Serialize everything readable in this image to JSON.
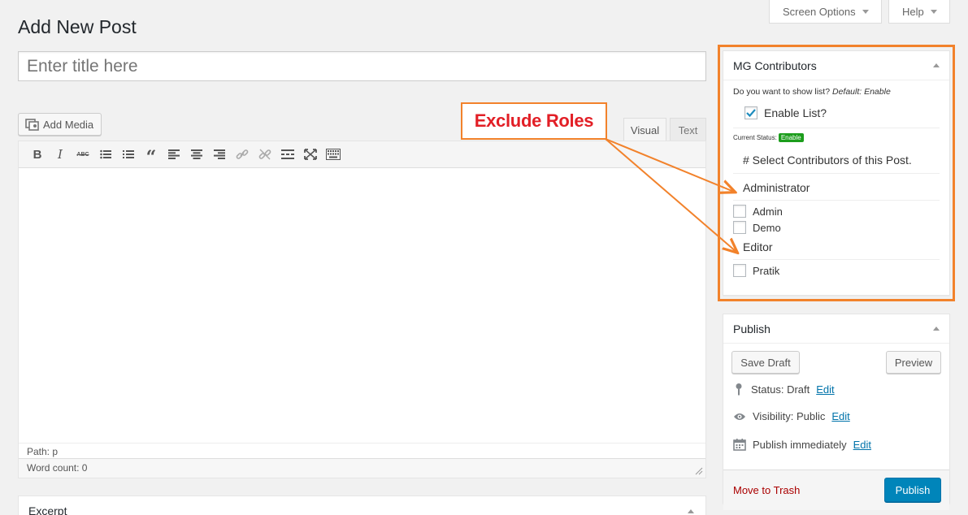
{
  "header": {
    "screen_options_label": "Screen Options",
    "help_label": "Help"
  },
  "page": {
    "title": "Add New Post",
    "title_placeholder": "Enter title here"
  },
  "editor": {
    "add_media_label": "Add Media",
    "tab_visual": "Visual",
    "tab_text": "Text",
    "toolbar_icons": [
      "bold-icon",
      "italic-icon",
      "strikethrough-icon",
      "bullet-list-icon",
      "numbered-list-icon",
      "blockquote-icon",
      "align-left-icon",
      "align-center-icon",
      "align-right-icon",
      "link-icon",
      "unlink-icon",
      "read-more-icon",
      "fullscreen-icon",
      "toolbar-toggle-icon"
    ],
    "path": "Path: p",
    "word_count": "Word count: 0"
  },
  "excerpt": {
    "title": "Excerpt"
  },
  "mg_contributors": {
    "title": "MG Contributors",
    "question": "Do you want to show list?",
    "default_text": "Default: Enable",
    "enable_label": "Enable List?",
    "enable_checked": true,
    "current_status_label": "Current Status:",
    "status_badge": "Enable",
    "select_title": "# Select Contributors of this Post.",
    "roles": [
      {
        "name": "Administrator",
        "users": [
          "Admin",
          "Demo"
        ]
      },
      {
        "name": "Editor",
        "users": [
          "Pratik"
        ]
      }
    ]
  },
  "publish": {
    "title": "Publish",
    "save_draft_label": "Save Draft",
    "preview_label": "Preview",
    "status_label": "Status: Draft",
    "visibility_label": "Visibility: Public",
    "schedule_label": "Publish immediately",
    "edit_label": "Edit",
    "trash_label": "Move to Trash",
    "publish_label": "Publish"
  },
  "annotation": {
    "label": "Exclude Roles",
    "color": "#f2822b",
    "text_color": "#e21f26"
  }
}
